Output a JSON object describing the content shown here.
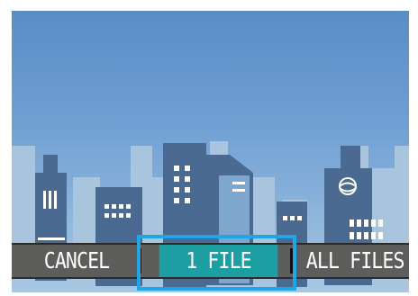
{
  "screen": {
    "menu": {
      "items": [
        {
          "label": "CANCEL"
        },
        {
          "label": "1 FILE"
        },
        {
          "label": "ALL FILES"
        }
      ],
      "selected_index": 1
    },
    "colors": {
      "selection_fill": "#1c9ea3",
      "focus_outline": "#1ea6e6",
      "menu_bar": "#5d5d5b"
    },
    "icons": [
      "globe-icon"
    ]
  }
}
